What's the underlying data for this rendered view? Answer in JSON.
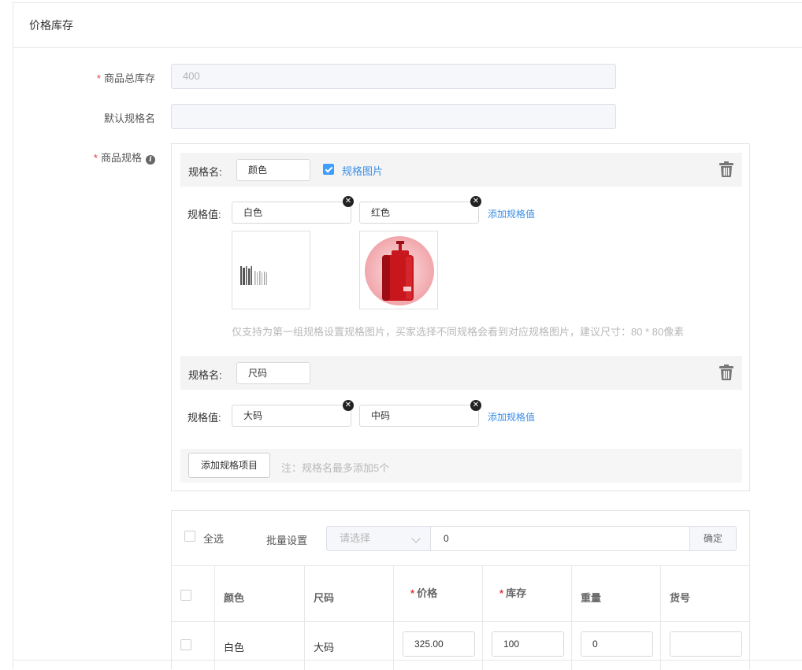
{
  "section_title": "价格库存",
  "total_stock": {
    "label": "商品总库存",
    "value": "400"
  },
  "default_spec_name": {
    "label": "默认规格名",
    "value": ""
  },
  "spec": {
    "label": "商品规格",
    "name_label": "规格名:",
    "value_label": "规格值:",
    "groups": [
      {
        "name": "颜色",
        "image_toggle_label": "规格图片",
        "values": [
          "白色",
          "红色"
        ],
        "add_value_label": "添加规格值"
      },
      {
        "name": "尺码",
        "values": [
          "大码",
          "中码"
        ],
        "add_value_label": "添加规格值"
      }
    ],
    "image_hint": "仅支持为第一组规格设置规格图片，买家选择不同规格会看到对应规格图片，建议尺寸：80 * 80像素",
    "add_item_button": "添加规格项目",
    "add_item_note": "注：规格名最多添加5个"
  },
  "batch": {
    "select_all_label": "全选",
    "batch_label": "批量设置",
    "select_placeholder": "请选择",
    "value": "0",
    "confirm_label": "确定"
  },
  "table": {
    "headers": [
      "颜色",
      "尺码",
      "价格",
      "库存",
      "重量",
      "货号"
    ],
    "rows": [
      {
        "color": "白色",
        "size": "大码",
        "price": "325.00",
        "stock": "100",
        "weight": "0",
        "sku": ""
      }
    ]
  }
}
